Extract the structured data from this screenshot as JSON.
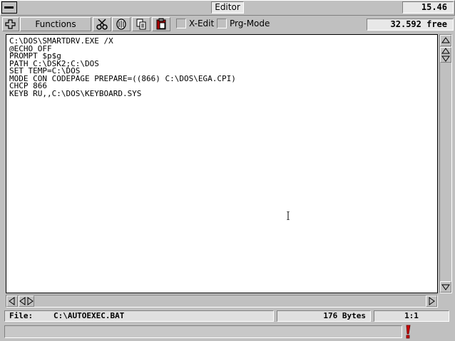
{
  "window": {
    "title": "Editor",
    "clock": "15.46"
  },
  "toolbar": {
    "add_icon": "plus-icon",
    "functions_label": "Functions",
    "tools": [
      {
        "name": "cut",
        "icon": "scissors-icon"
      },
      {
        "name": "delete",
        "icon": "trash-icon"
      },
      {
        "name": "copy",
        "icon": "copy-icon"
      },
      {
        "name": "paste",
        "icon": "paste-icon"
      }
    ],
    "xedit_label": "X-Edit",
    "prgmode_label": "Prg-Mode",
    "free_memory": "32.592  free"
  },
  "editor": {
    "content": "C:\\DOS\\SMARTDRV.EXE /X\n@ECHO OFF\nPROMPT $p$g\nPATH C:\\DSK2;C:\\DOS\nSET TEMP=C:\\DOS\nMODE CON CODEPAGE PREPARE=((866) C:\\DOS\\EGA.CPI)\nCHCP 866\nKEYB RU,,C:\\DOS\\KEYBOARD.SYS"
  },
  "status": {
    "file_label": "File:",
    "file_path": "C:\\AUTOEXEC.BAT",
    "size": "176 Bytes",
    "position": "1:1"
  },
  "colors": {
    "face": "#c0c0c0",
    "editor_bg": "#ffffff",
    "alert": "#cc0000"
  }
}
